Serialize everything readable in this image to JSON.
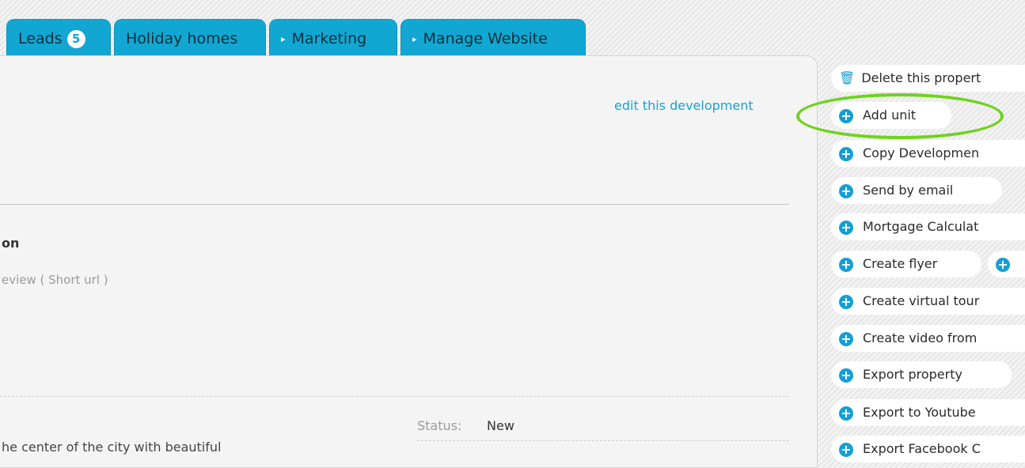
{
  "tabs": [
    {
      "label": "Leads",
      "badge": "5",
      "arrow": ""
    },
    {
      "label": "Holiday homes",
      "arrow": ""
    },
    {
      "label": "Marketing",
      "arrow": "▸"
    },
    {
      "label": "Manage Website",
      "arrow": "▸"
    }
  ],
  "main": {
    "edit_link": "edit this development",
    "section_title": "on",
    "preview_text": "eview ( Short url )",
    "status_label": "Status:",
    "status_value": "New",
    "description": "he center of the city with beautiful"
  },
  "actions": [
    {
      "label": "Delete this propert",
      "icon": "trash-icon"
    },
    {
      "label": "Add unit",
      "icon": "plus-icon"
    },
    {
      "label": "Copy Developmen",
      "icon": "plus-icon"
    },
    {
      "label": "Send by email",
      "icon": "plus-icon"
    },
    {
      "label": "Mortgage Calculat",
      "icon": "plus-icon"
    },
    {
      "label": "Create flyer",
      "icon": "plus-icon"
    },
    {
      "label": "Create virtual tour",
      "icon": "plus-icon"
    },
    {
      "label": "Create video from",
      "icon": "plus-icon"
    },
    {
      "label": "Export property",
      "icon": "plus-icon"
    },
    {
      "label": "Export to Youtube",
      "icon": "plus-icon"
    },
    {
      "label": "Export Facebook C",
      "icon": "plus-icon"
    }
  ],
  "colors": {
    "accent": "#11a7d2",
    "highlight": "#6fd21c",
    "link": "#1aa1d4"
  }
}
